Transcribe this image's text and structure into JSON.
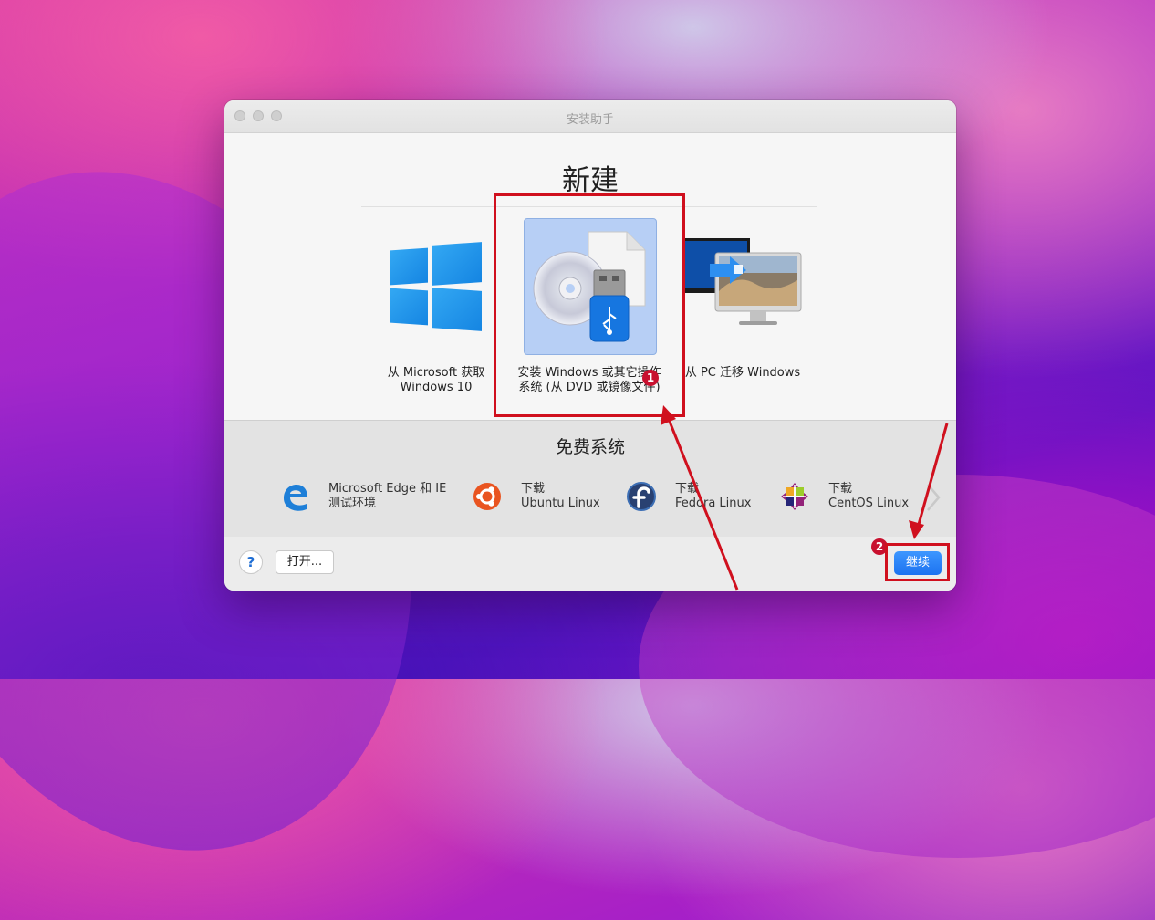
{
  "window": {
    "title": "安装助手"
  },
  "main": {
    "heading": "新建",
    "options": [
      {
        "lines": [
          "从 Microsoft",
          "获取 Windows 10"
        ],
        "icon": "windows-logo-icon"
      },
      {
        "lines": [
          "安装 Windows",
          "或其它操作系统",
          "(从 DVD 或镜像文件)"
        ],
        "icon": "dvd-usb-image-icon",
        "selected": true
      },
      {
        "lines": [
          "从 PC 迁移",
          "Windows"
        ],
        "icon": "pc-to-mac-migration-icon"
      }
    ]
  },
  "free_systems": {
    "title": "免费系统",
    "items": [
      {
        "lines": [
          "Microsoft Edge 和 IE",
          "测试环境"
        ],
        "icon": "edge-icon"
      },
      {
        "lines": [
          "下载",
          "Ubuntu Linux"
        ],
        "icon": "ubuntu-icon"
      },
      {
        "lines": [
          "下载",
          "Fedora Linux"
        ],
        "icon": "fedora-icon"
      },
      {
        "lines": [
          "下载",
          "CentOS Linux"
        ],
        "icon": "centos-icon"
      }
    ]
  },
  "footer": {
    "help_label": "?",
    "open_label": "打开...",
    "continue_label": "继续"
  },
  "annotations": {
    "badge1": "1",
    "badge2": "2",
    "color": "#d0101e"
  }
}
